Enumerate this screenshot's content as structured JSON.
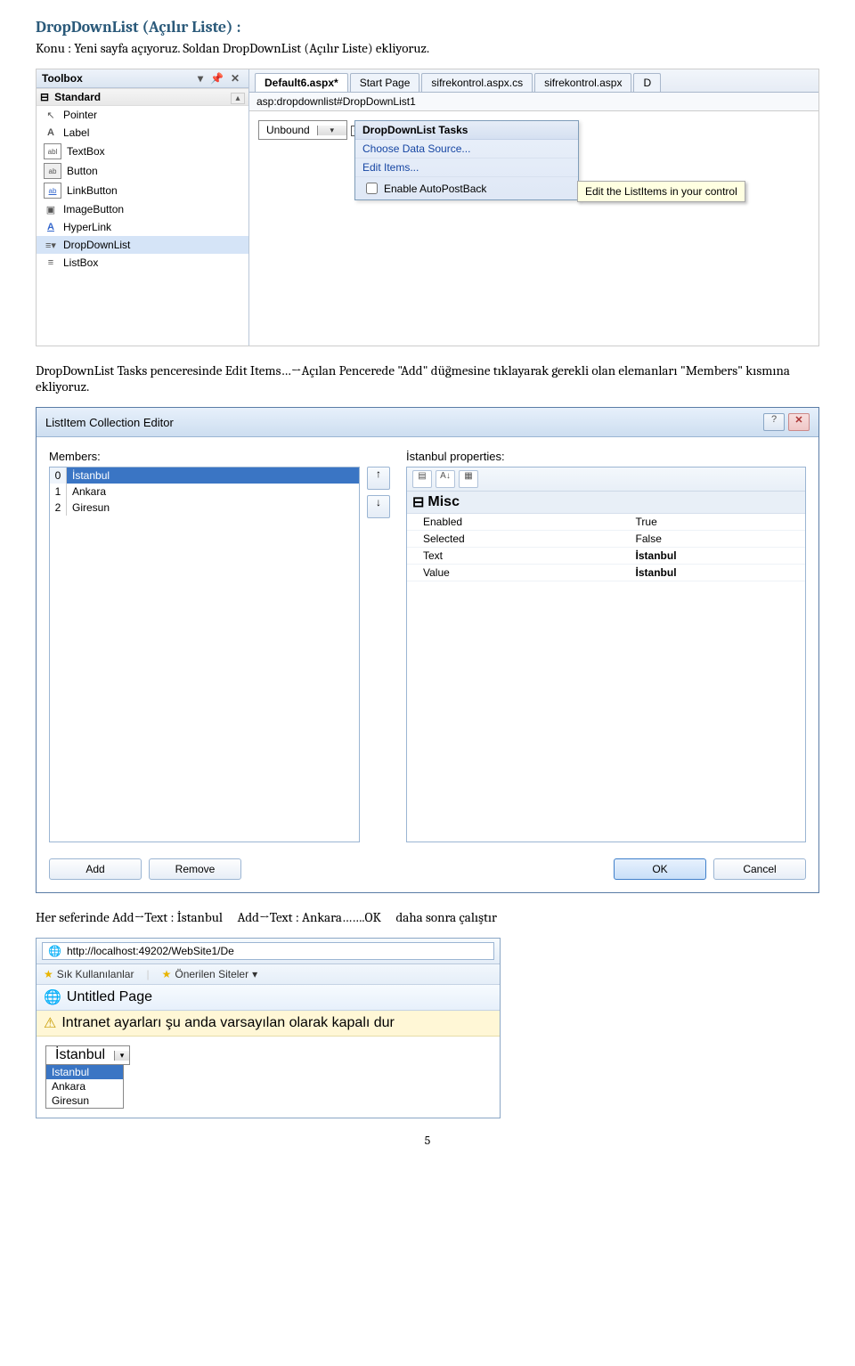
{
  "doc": {
    "title": "DropDownList (Açılır Liste) :",
    "intro": "Konu : Yeni sayfa açıyoruz. Soldan DropDownList (Açılır Liste) ekliyoruz.",
    "para2": "DropDownList Tasks penceresinde Edit Items…→Açılan Pencerede \"Add\" düğmesine tıklayarak gerekli olan elemanları \"Members\" kısmına ekliyoruz.",
    "para3_left": "Her seferinde Add→Text : İstanbul",
    "para3_mid": "Add→Text : Ankara…….OK",
    "para3_right": "daha sonra çalıştır",
    "page_number": "5"
  },
  "toolbox": {
    "title": "Toolbox",
    "category": "Standard",
    "items": [
      "Pointer",
      "Label",
      "TextBox",
      "Button",
      "LinkButton",
      "ImageButton",
      "HyperLink",
      "DropDownList",
      "ListBox"
    ],
    "icon_glyphs": [
      "↖",
      "A",
      "abl",
      "ab",
      "ab",
      "▣",
      "A",
      "≡▾",
      "≡"
    ]
  },
  "designer": {
    "tabs": [
      "Default6.aspx*",
      "Start Page",
      "sifrekontrol.aspx.cs",
      "sifrekontrol.aspx",
      "D"
    ],
    "active_tab": 0,
    "breadcrumb": "asp:dropdownlist#DropDownList1",
    "ddl_text": "Unbound",
    "smart_title": "DropDownList Tasks",
    "smart_items": [
      "Choose Data Source...",
      "Edit Items..."
    ],
    "smart_check": "Enable AutoPostBack",
    "tooltip": "Edit the ListItems in your control"
  },
  "editor": {
    "title": "ListItem Collection Editor",
    "members_label": "Members:",
    "props_label": "İstanbul properties:",
    "members": [
      "İstanbul",
      "Ankara",
      "Giresun"
    ],
    "category": "Misc",
    "properties": [
      {
        "name": "Enabled",
        "value": "True",
        "bold": false
      },
      {
        "name": "Selected",
        "value": "False",
        "bold": false
      },
      {
        "name": "Text",
        "value": "İstanbul",
        "bold": true
      },
      {
        "name": "Value",
        "value": "İstanbul",
        "bold": true
      }
    ],
    "add_btn": "Add",
    "remove_btn": "Remove",
    "ok_btn": "OK",
    "cancel_btn": "Cancel"
  },
  "browser": {
    "url": "http://localhost:49202/WebSite1/De",
    "fav_btn": "Sık Kullanılanlar",
    "fav_link": "Önerilen Siteler",
    "page_title": "Untitled Page",
    "infobar": "Intranet ayarları şu anda varsayılan olarak kapalı dur",
    "combo_value": "İstanbul",
    "options": [
      "Istanbul",
      "Ankara",
      "Giresun"
    ]
  }
}
